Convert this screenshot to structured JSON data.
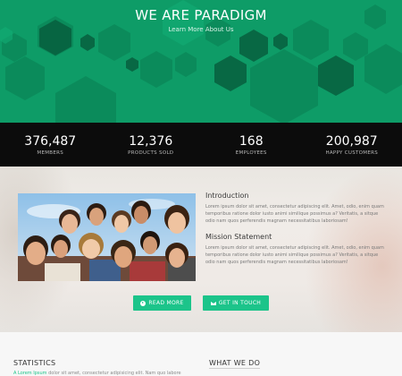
{
  "hero": {
    "title": "WE ARE PARADIGM",
    "link": "Learn More About Us",
    "bg_color": "#0e9c67"
  },
  "stats": [
    {
      "value": "376,487",
      "label": "MEMBERS"
    },
    {
      "value": "12,376",
      "label": "PRODUCTS SOLD"
    },
    {
      "value": "168",
      "label": "EMPLOYEES"
    },
    {
      "value": "200,987",
      "label": "HAPPY CUSTOMERS"
    }
  ],
  "about": {
    "intro_title": "Introduction",
    "intro_text": "Lorem ipsum dolor sit amet, consectetur adipiscing elit. Amet, odio, enim quam temporibus ratione dolor iusto animi similique possimus a? Veritatis, a sitque odio nam quos perferendis magnam necessitatibus laboriosam!",
    "mission_title": "Mission Statement",
    "mission_text": "Lorem ipsum dolor sit amet, consectetur adipiscing elit. Amet, odio, enim quam temporibus ratione dolor iusto animi similique possimus a? Veritatis, a sitque odio nam quos perferendis magnam necessitatibus laboriosam!",
    "read_more": "READ MORE",
    "get_in_touch": "GET IN TOUCH",
    "accent_color": "#1cc48a"
  },
  "bottom": {
    "statistics_title": "STATISTICS",
    "what_we_do_title": "WHAT WE DO",
    "statistics_text_accent": "A Lorem Ipsum",
    "statistics_text_rest": " dolor sit amet, consectetur adipisicing elit. Nam quo labore"
  }
}
